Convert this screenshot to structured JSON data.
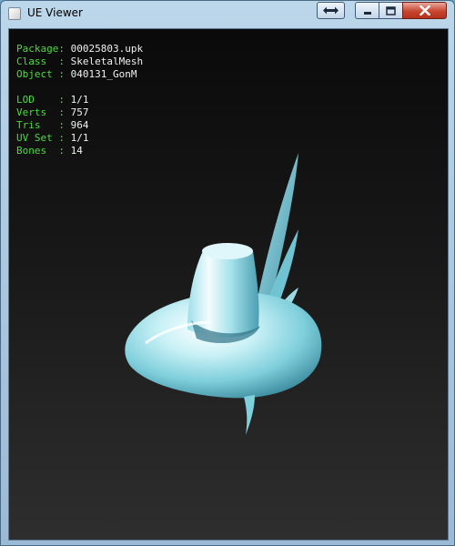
{
  "window": {
    "title": "UE Viewer"
  },
  "info": {
    "package_label": "Package:",
    "package_value": "00025803.upk",
    "class_label": "Class  :",
    "class_value": "SkeletalMesh",
    "object_label": "Object :",
    "object_value": "040131_GonM",
    "lod_label": "LOD    :",
    "lod_value": "1/1",
    "verts_label": "Verts  :",
    "verts_value": "757",
    "tris_label": "Tris   :",
    "tris_value": "964",
    "uvset_label": "UV Set :",
    "uvset_value": "1/1",
    "bones_label": "Bones  :",
    "bones_value": "14"
  },
  "colors": {
    "label": "#4bdc3e",
    "value": "#f0f0f0",
    "viewport_background": "#1a1a1a",
    "mesh": "#8fd6e3",
    "close_button": "#c7462f"
  },
  "icons": {
    "app": "app-icon",
    "toggle": "double-arrow-icon",
    "minimize": "minimize-icon",
    "maximize": "maximize-icon",
    "close": "close-icon"
  }
}
